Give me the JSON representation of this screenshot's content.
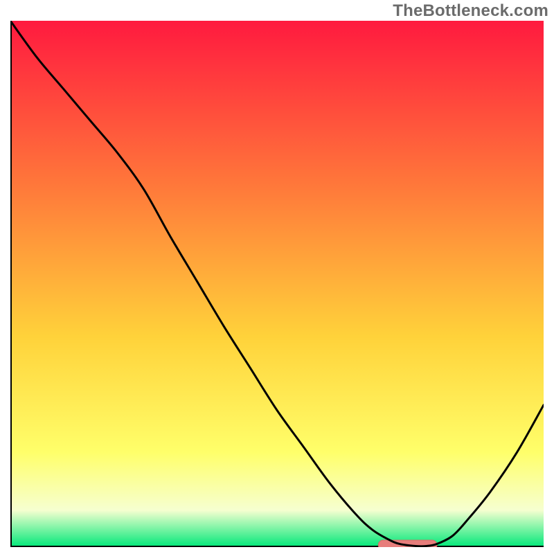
{
  "watermark": "TheBottleneck.com",
  "colors": {
    "gradient_top": "#ff1a3f",
    "gradient_mid1": "#ff7a3a",
    "gradient_mid2": "#ffd23a",
    "gradient_mid3": "#ffff6a",
    "gradient_pale": "#f6ffd0",
    "gradient_green": "#00e879",
    "axis": "#000000",
    "curve": "#000000",
    "marker_fill": "#e77d7b",
    "marker_stroke": "#de6866"
  },
  "chart_data": {
    "type": "line",
    "title": "",
    "xlabel": "",
    "ylabel": "",
    "xlim": [
      0,
      100
    ],
    "ylim": [
      0,
      100
    ],
    "legend": false,
    "grid": false,
    "note": "Axes carry no tick labels; values are relative plot-area percentages read off geometry.",
    "series": [
      {
        "name": "bottleneck-curve",
        "x": [
          0,
          5,
          10,
          15,
          20,
          25,
          30,
          35,
          40,
          45,
          50,
          55,
          60,
          65,
          68,
          71,
          73,
          76,
          78,
          80,
          83,
          86,
          90,
          95,
          100
        ],
        "y": [
          100,
          93,
          87,
          81,
          75,
          68,
          59,
          50.5,
          42,
          34,
          26,
          19,
          12,
          6,
          3.2,
          1.4,
          0.6,
          0.2,
          0.2,
          0.6,
          2.2,
          5.5,
          10.5,
          18,
          27
        ]
      }
    ],
    "marker": {
      "name": "optimal-range-marker",
      "shape": "rounded-bar",
      "x_start": 69,
      "x_end": 80,
      "y": 0.4,
      "fill": "#e77d7b"
    }
  }
}
